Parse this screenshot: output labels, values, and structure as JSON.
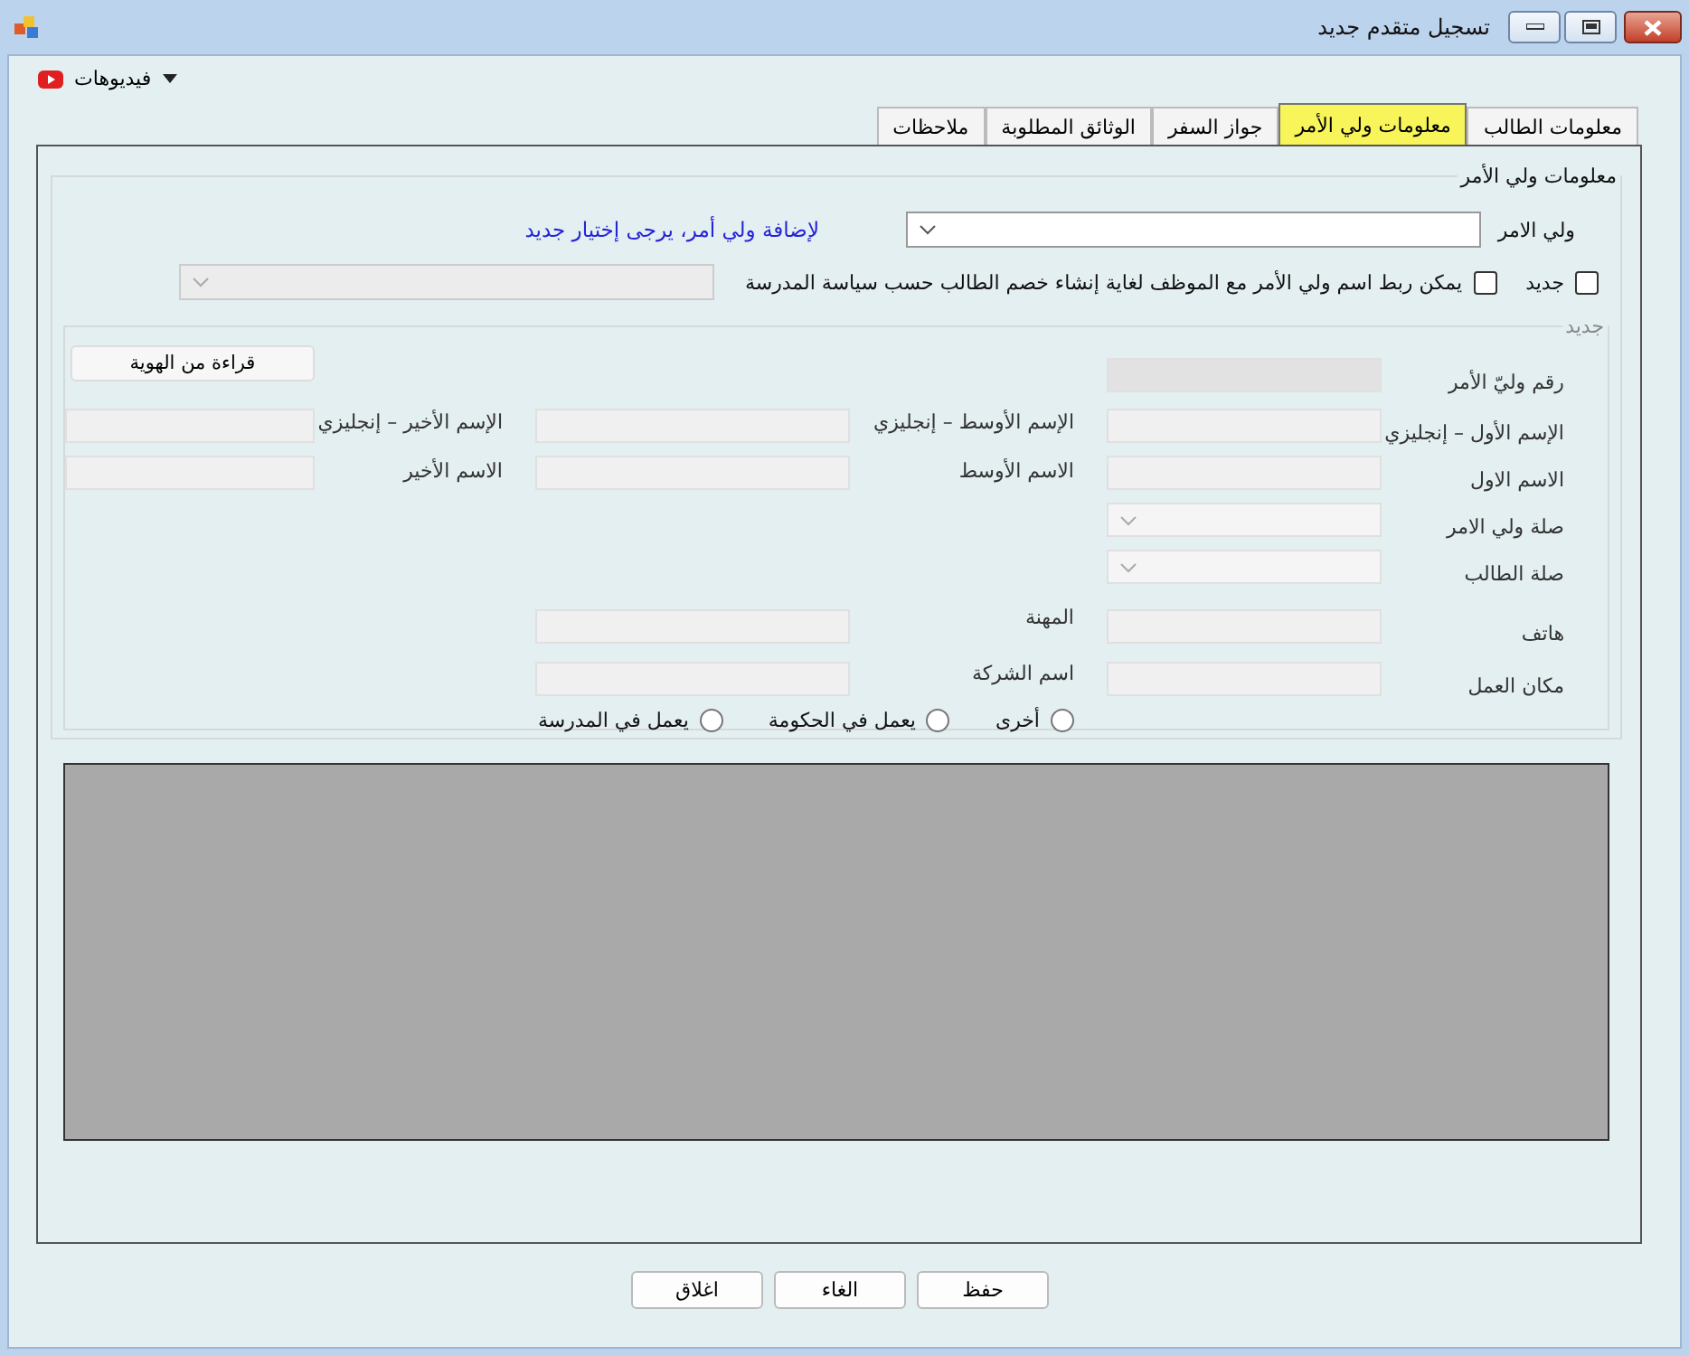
{
  "window": {
    "title": "تسجيل متقدم جديد"
  },
  "menu": {
    "label": "فيديوهات"
  },
  "tabs": [
    {
      "label": "معلومات الطالب",
      "selected": false
    },
    {
      "label": "معلومات ولي الأمر",
      "selected": true
    },
    {
      "label": "جواز السفر",
      "selected": false
    },
    {
      "label": "الوثائق المطلوبة",
      "selected": false
    },
    {
      "label": "ملاحظات",
      "selected": false
    }
  ],
  "guardian_group": {
    "title": "معلومات ولي الأمر",
    "guardian_label": "ولي الامر",
    "add_hint": "لإضافة ولي أمر، يرجى إختيار جديد",
    "new_checkbox": {
      "label": "جديد",
      "checked": false
    },
    "link_checkbox": {
      "label": "يمكن ربط اسم ولي الأمر مع الموظف لغاية إنشاء خصم الطالب حسب سياسة المدرسة",
      "checked": false
    }
  },
  "new_group": {
    "title": "جديد",
    "read_id_button": "قراءة من الهوية",
    "rows": [
      [
        {
          "label": "رقم وليّ الأمر",
          "kind": "readonly"
        }
      ],
      [
        {
          "label": "الإسم الأول – إنجليزي",
          "kind": "text"
        },
        {
          "label": "الإسم الأوسط – إنجليزي",
          "kind": "text"
        },
        {
          "label": "الإسم الأخير – إنجليزي",
          "kind": "text"
        }
      ],
      [
        {
          "label": "الاسم الاول",
          "kind": "text"
        },
        {
          "label": "الاسم الأوسط",
          "kind": "text"
        },
        {
          "label": "الاسم الأخير",
          "kind": "text"
        }
      ],
      [
        {
          "label": "صلة ولي الامر",
          "kind": "combo"
        }
      ],
      [
        {
          "label": "صلة الطالب",
          "kind": "combo"
        }
      ],
      [
        {
          "label": "هاتف",
          "kind": "text"
        },
        {
          "label": "المهنة",
          "kind": "text"
        }
      ],
      [
        {
          "label": "مكان العمل",
          "kind": "text"
        },
        {
          "label": "اسم الشركة",
          "kind": "text"
        }
      ]
    ],
    "work_options": [
      {
        "label": "أخرى",
        "selected": false
      },
      {
        "label": "يعمل في الحكومة",
        "selected": false
      },
      {
        "label": "يعمل في المدرسة",
        "selected": false
      }
    ]
  },
  "buttons": [
    "حفظ",
    "الغاء",
    "اغلاق"
  ]
}
